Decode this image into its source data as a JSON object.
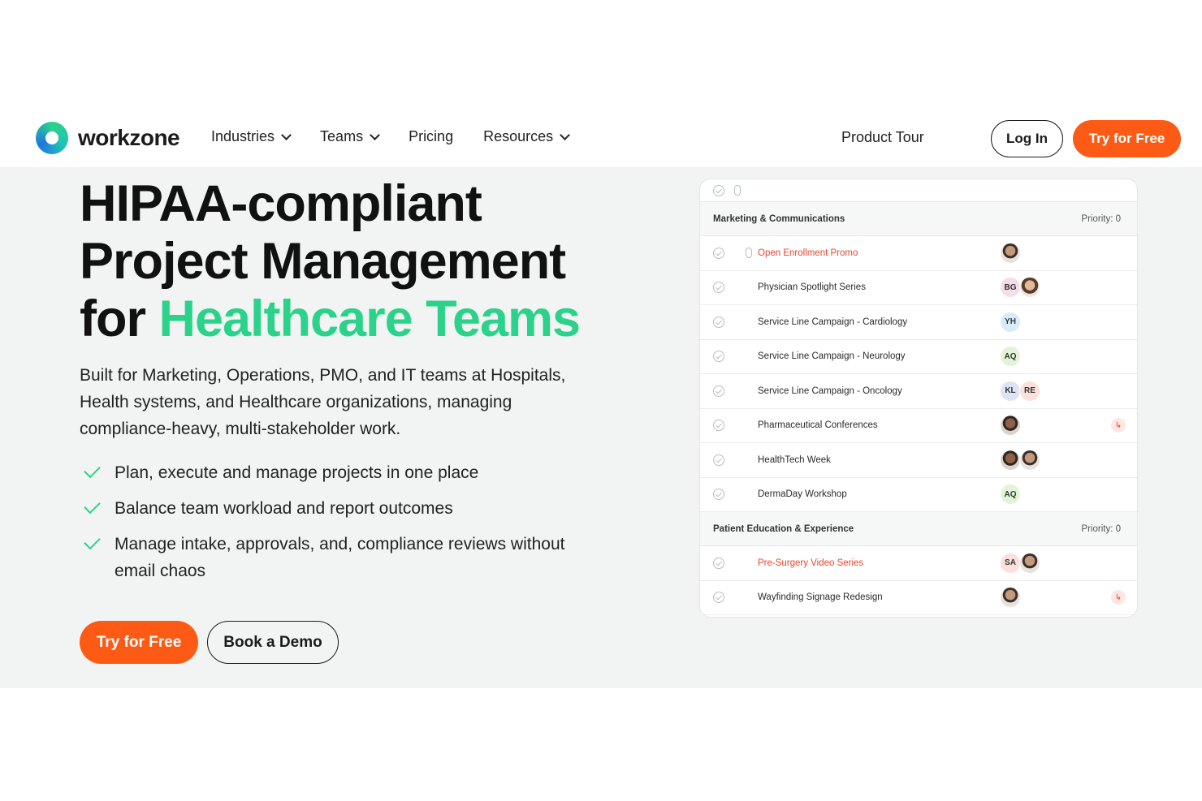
{
  "nav": {
    "logo_text": "workzone",
    "links": [
      {
        "label": "Industries",
        "dropdown": true
      },
      {
        "label": "Teams",
        "dropdown": true
      },
      {
        "label": "Pricing",
        "dropdown": false
      },
      {
        "label": "Resources",
        "dropdown": true
      }
    ],
    "product_tour": "Product Tour",
    "login": "Log In",
    "try_free": "Try for Free"
  },
  "hero": {
    "headline_line1": "HIPAA-compliant",
    "headline_line2": "Project Management",
    "headline_line3_prefix": "for ",
    "headline_line3_accent": "Healthcare Teams",
    "subheading": "Built for Marketing, Operations, PMO, and IT teams at Hospitals, Health systems, and Healthcare organizations, managing compliance-heavy, multi-stakeholder work.",
    "bullets": [
      "Plan, execute and manage projects in one place",
      "Balance team workload and report outcomes",
      "Manage intake, approvals, and, compliance reviews without email chaos"
    ],
    "cta_primary": "Try for Free",
    "cta_secondary": "Book a Demo"
  },
  "panel": {
    "groups": [
      {
        "name": "Marketing & Communications",
        "priority": "Priority: 0",
        "tasks": [
          {
            "name": "Open Enrollment Promo",
            "red": true,
            "attachment": true,
            "avatars": [
              {
                "type": "photo"
              }
            ],
            "subtask": false
          },
          {
            "name": "Physician Spotlight Series",
            "red": false,
            "avatars": [
              {
                "initials": "BG",
                "color": "#f3dde6"
              },
              {
                "type": "photo3"
              }
            ],
            "subtask": false
          },
          {
            "name": "Service Line Campaign - Cardiology",
            "red": false,
            "avatars": [
              {
                "initials": "YH",
                "color": "#d8ecf8"
              }
            ],
            "subtask": false
          },
          {
            "name": "Service Line Campaign - Neurology",
            "red": false,
            "avatars": [
              {
                "initials": "AQ",
                "color": "#e2f4d8"
              }
            ],
            "subtask": false
          },
          {
            "name": "Service Line Campaign - Oncology",
            "red": false,
            "avatars": [
              {
                "initials": "KL",
                "color": "#dfe3f6"
              },
              {
                "initials": "RE",
                "color": "#fbe0dc"
              }
            ],
            "subtask": false
          },
          {
            "name": "Pharmaceutical Conferences",
            "red": false,
            "avatars": [
              {
                "type": "photo2"
              }
            ],
            "subtask": true
          },
          {
            "name": "HealthTech Week",
            "red": false,
            "avatars": [
              {
                "type": "photo2"
              },
              {
                "type": "photo"
              }
            ],
            "subtask": false
          },
          {
            "name": "DermaDay Workshop",
            "red": false,
            "avatars": [
              {
                "initials": "AQ",
                "color": "#e2f4d8"
              }
            ],
            "subtask": false
          }
        ]
      },
      {
        "name": "Patient Education & Experience",
        "priority": "Priority: 0",
        "tasks": [
          {
            "name": "Pre-Surgery Video Series",
            "red": true,
            "avatars": [
              {
                "initials": "SA",
                "color": "#fbe0dc"
              },
              {
                "type": "photo"
              }
            ],
            "subtask": false
          },
          {
            "name": "Wayfinding Signage Redesign",
            "red": false,
            "avatars": [
              {
                "type": "photo"
              }
            ],
            "subtask": true
          }
        ]
      }
    ],
    "subtask_glyph": "↳"
  },
  "colors": {
    "accent_orange": "#fd5a15",
    "accent_green": "#2bd38a",
    "task_red": "#e8452c",
    "hero_bg": "#f2f3f3"
  }
}
